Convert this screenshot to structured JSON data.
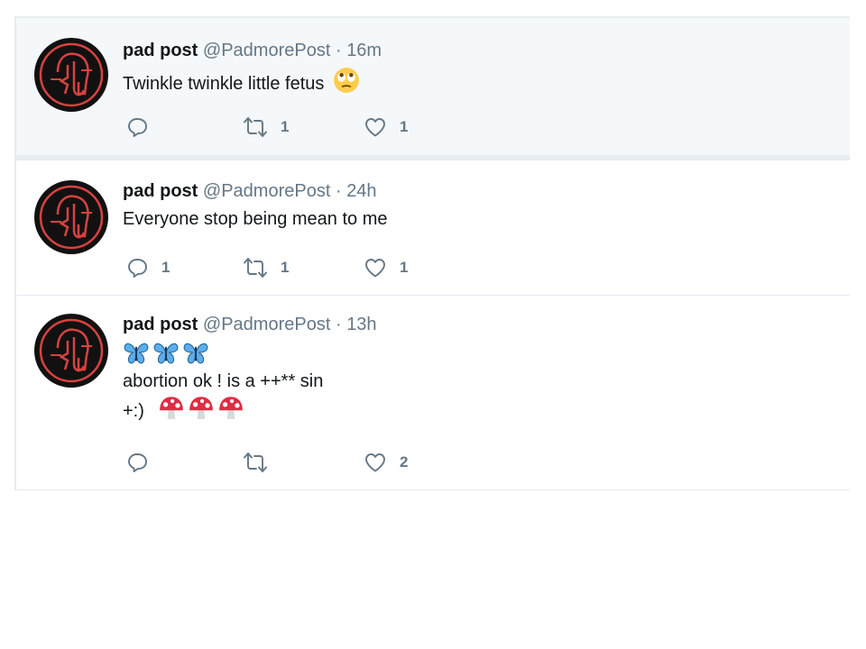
{
  "tweets": [
    {
      "name": "pad post",
      "handle": "@PadmorePost",
      "separator": "·",
      "time": "16m",
      "text": "Twinkle twinkle little fetus",
      "emoji": "rolling-eyes-face",
      "highlighted": true,
      "actions": {
        "reply_icon": "reply-icon",
        "reply_count": "",
        "retweet_icon": "retweet-icon",
        "retweet_count": "1",
        "like_icon": "heart-icon",
        "like_count": "1"
      }
    },
    {
      "name": "pad post",
      "handle": "@PadmorePost",
      "separator": "·",
      "time": "24h",
      "text": "Everyone stop being mean to me",
      "highlighted": false,
      "actions": {
        "reply_icon": "reply-icon",
        "reply_count": "1",
        "retweet_icon": "retweet-icon",
        "retweet_count": "1",
        "like_icon": "heart-icon",
        "like_count": "1"
      }
    },
    {
      "name": "pad post",
      "handle": "@PadmorePost",
      "separator": "·",
      "time": "13h",
      "line1_emoji": [
        "butterfly",
        "butterfly",
        "butterfly"
      ],
      "line2": "abortion ok ! is a ++** sin",
      "line3": "+:)",
      "line3_emoji": [
        "mushroom",
        "mushroom",
        "mushroom"
      ],
      "highlighted": false,
      "actions": {
        "reply_icon": "reply-icon",
        "reply_count": "",
        "retweet_icon": "retweet-icon",
        "retweet_count": "",
        "like_icon": "heart-icon",
        "like_count": "2"
      }
    }
  ],
  "colors": {
    "avatar_bg": "#111111",
    "avatar_line": "#d8423e",
    "icon_gray": "#657786",
    "highlight_bg": "#f5f8fa",
    "border": "#e6ecf0"
  }
}
